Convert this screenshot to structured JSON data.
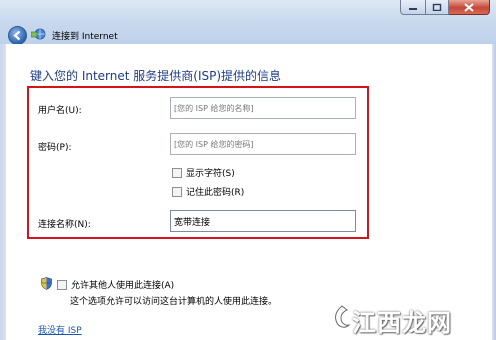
{
  "window": {
    "title": "连接到 Internet",
    "controls": {
      "minimize": "minimize-icon",
      "maximize": "maximize-icon",
      "close": "close-icon"
    }
  },
  "header": {
    "title": "键入您的 Internet 服务提供商(ISP)提供的信息"
  },
  "form": {
    "username_label": "用户名(U):",
    "username_placeholder": "[您的 ISP 给您的名称]",
    "password_label": "密码(P):",
    "password_placeholder": "[您的 ISP 给您的密码]",
    "show_chars_label": "显示字符(S)",
    "remember_label": "记住此密码(R)",
    "connection_name_label": "连接名称(N):",
    "connection_name_value": "宽带连接"
  },
  "options": {
    "allow_others_label": "允许其他人使用此连接(A)",
    "allow_others_desc": "这个选项允许可以访问这台计算机的人使用此连接。",
    "no_isp_link": "我没有 ISP"
  },
  "watermark": {
    "text": "江西龙网"
  },
  "colors": {
    "highlight": "#d8121b",
    "heading": "#1e3b8a",
    "link": "#1b56b3"
  }
}
